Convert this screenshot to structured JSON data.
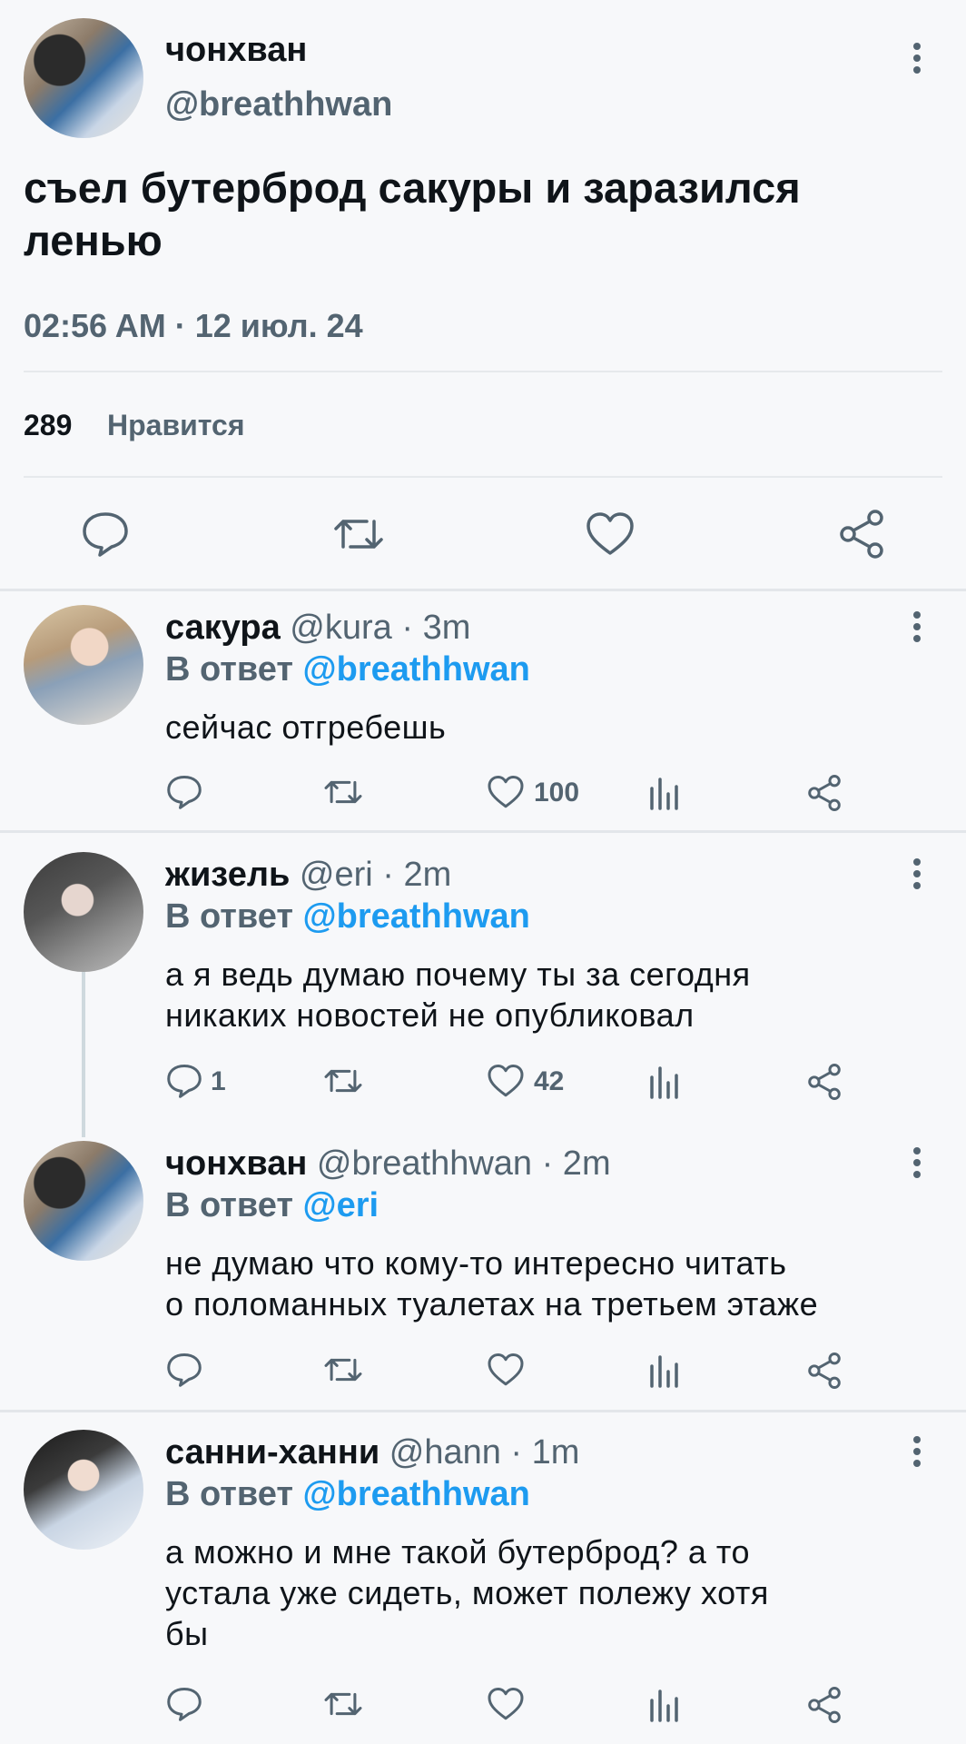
{
  "tweet": {
    "author_name": "чонхван",
    "author_handle": "@breathhwan",
    "text_line1": "съел бутерброд сакуры и заразился",
    "text_line2": "ленью",
    "timestamp": "02:56 AM · 12 июл. 24",
    "likes_count": "289",
    "likes_label": "Нравится",
    "icons": [
      "reply-icon",
      "retweet-icon",
      "like-icon",
      "share-icon",
      "more-icon"
    ]
  },
  "replies": [
    {
      "name": "сакура",
      "meta": "@kura · 3m",
      "reply_prefix": "В ответ ",
      "reply_to": "@breathhwan",
      "lines": [
        "сейчас отгребешь"
      ],
      "reply_count": "",
      "like_count": "100"
    },
    {
      "name": "жизель",
      "meta": "@eri · 2m",
      "reply_prefix": "В ответ ",
      "reply_to": "@breathhwan",
      "lines": [
        "а я ведь думаю почему ты за сегодня",
        "никаких новостей не опубликовал"
      ],
      "reply_count": "1",
      "like_count": "42"
    },
    {
      "name": "чонхван",
      "meta": "@breathhwan · 2m",
      "reply_prefix": "В ответ ",
      "reply_to": "@eri",
      "lines": [
        "не думаю что кому-то интересно читать",
        "о поломанных туалетах на третьем этаже"
      ],
      "reply_count": "",
      "like_count": ""
    },
    {
      "name": "санни-ханни",
      "meta": "@hann · 1m",
      "reply_prefix": "В ответ ",
      "reply_to": "@breathhwan",
      "lines": [
        "а можно и мне такой бутерброд? а то",
        "устала уже сидеть, может полежу хотя",
        "бы"
      ],
      "reply_count": "",
      "like_count": ""
    }
  ],
  "colors": {
    "accent": "#1d9bf0",
    "muted": "#536471",
    "text": "#0f1419",
    "background": "#f7f8fa"
  }
}
